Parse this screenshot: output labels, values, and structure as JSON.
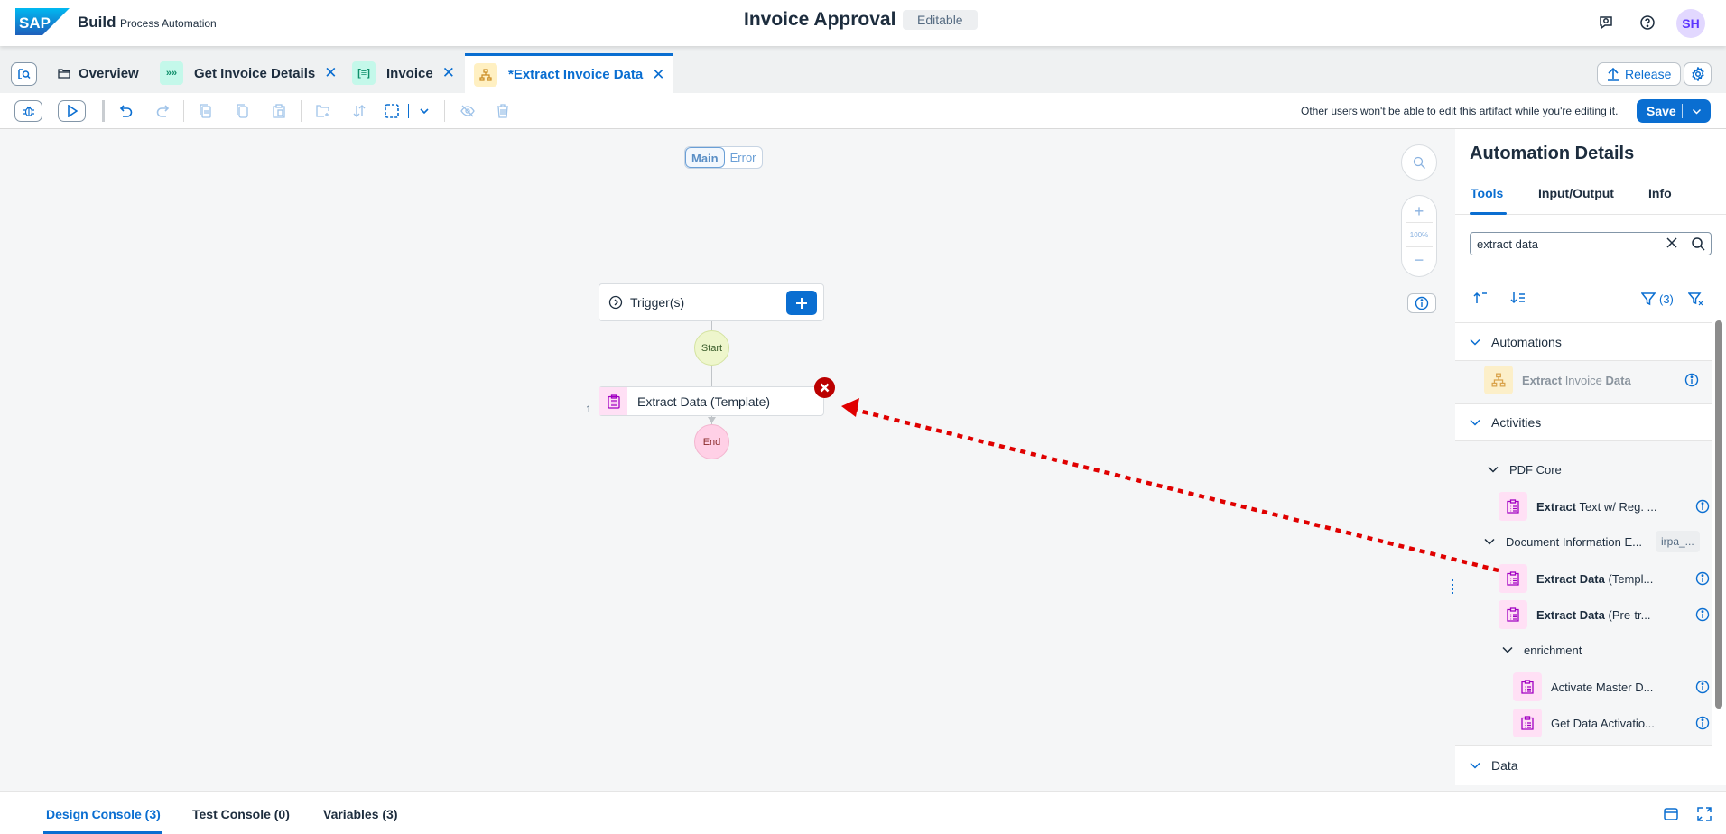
{
  "shell": {
    "logo": "SAP",
    "brand": "Build",
    "product": "Process Automation",
    "title": "Invoice Approval",
    "status_badge": "Editable",
    "avatar_initials": "SH",
    "icons": [
      "feedback-icon",
      "help-icon"
    ]
  },
  "tabs": {
    "search_button_icon": "search-artifact-icon",
    "items": [
      {
        "label": "Overview",
        "icon": "folder-icon",
        "closable": false
      },
      {
        "label": "Get Invoice Details",
        "icon": "process-icon",
        "closable": true
      },
      {
        "label": "Invoice",
        "icon": "form-icon",
        "closable": true
      },
      {
        "label": "*Extract Invoice Data",
        "icon": "automation-icon",
        "closable": true,
        "active": true
      }
    ],
    "release_label": "Release"
  },
  "toolbar": {
    "notice": "Other users won't be able to edit this artifact while you're editing it.",
    "save_label": "Save"
  },
  "canvas": {
    "view_toggle": {
      "main": "Main",
      "error": "Error",
      "selected": "Main"
    },
    "trigger_label": "Trigger(s)",
    "start_label": "Start",
    "end_label": "End",
    "activity": {
      "step": "1",
      "label": "Extract Data (Template)",
      "has_error": true
    },
    "zoom_level": "100%"
  },
  "panel": {
    "title": "Automation Details",
    "tabs": [
      "Tools",
      "Input/Output",
      "Info"
    ],
    "active_tab": "Tools",
    "search_value": "extract data",
    "filter_count": "(3)",
    "sections": {
      "automations": {
        "label": "Automations",
        "items": [
          {
            "bold1": "Extract",
            "mid": " Invoice ",
            "bold2": "Data",
            "rest": ""
          }
        ]
      },
      "activities": {
        "label": "Activities",
        "groups": {
          "pdf_core": {
            "label": "PDF Core",
            "items": [
              {
                "bold": "Extract",
                "rest": " Text w/ Reg. ..."
              }
            ]
          },
          "doc_info": {
            "label": "Document Information E...",
            "tag": "irpa_...",
            "items": [
              {
                "bold": "Extract Data",
                "rest": " (Templ..."
              },
              {
                "bold": "Extract Data",
                "rest": " (Pre-tr..."
              }
            ]
          },
          "enrichment": {
            "label": "enrichment",
            "items": [
              {
                "label": "Activate Master D..."
              },
              {
                "label": "Get Data Activatio..."
              }
            ]
          }
        }
      },
      "data": {
        "label": "Data"
      }
    }
  },
  "console": {
    "tabs": [
      "Design Console (3)",
      "Test Console (0)",
      "Variables (3)"
    ],
    "active_tab": "Design Console (3)"
  },
  "annotation": {
    "color": "#e00000",
    "from": "Extract Data (Templ... in tool panel",
    "to": "Extract Data (Template) node on canvas"
  }
}
